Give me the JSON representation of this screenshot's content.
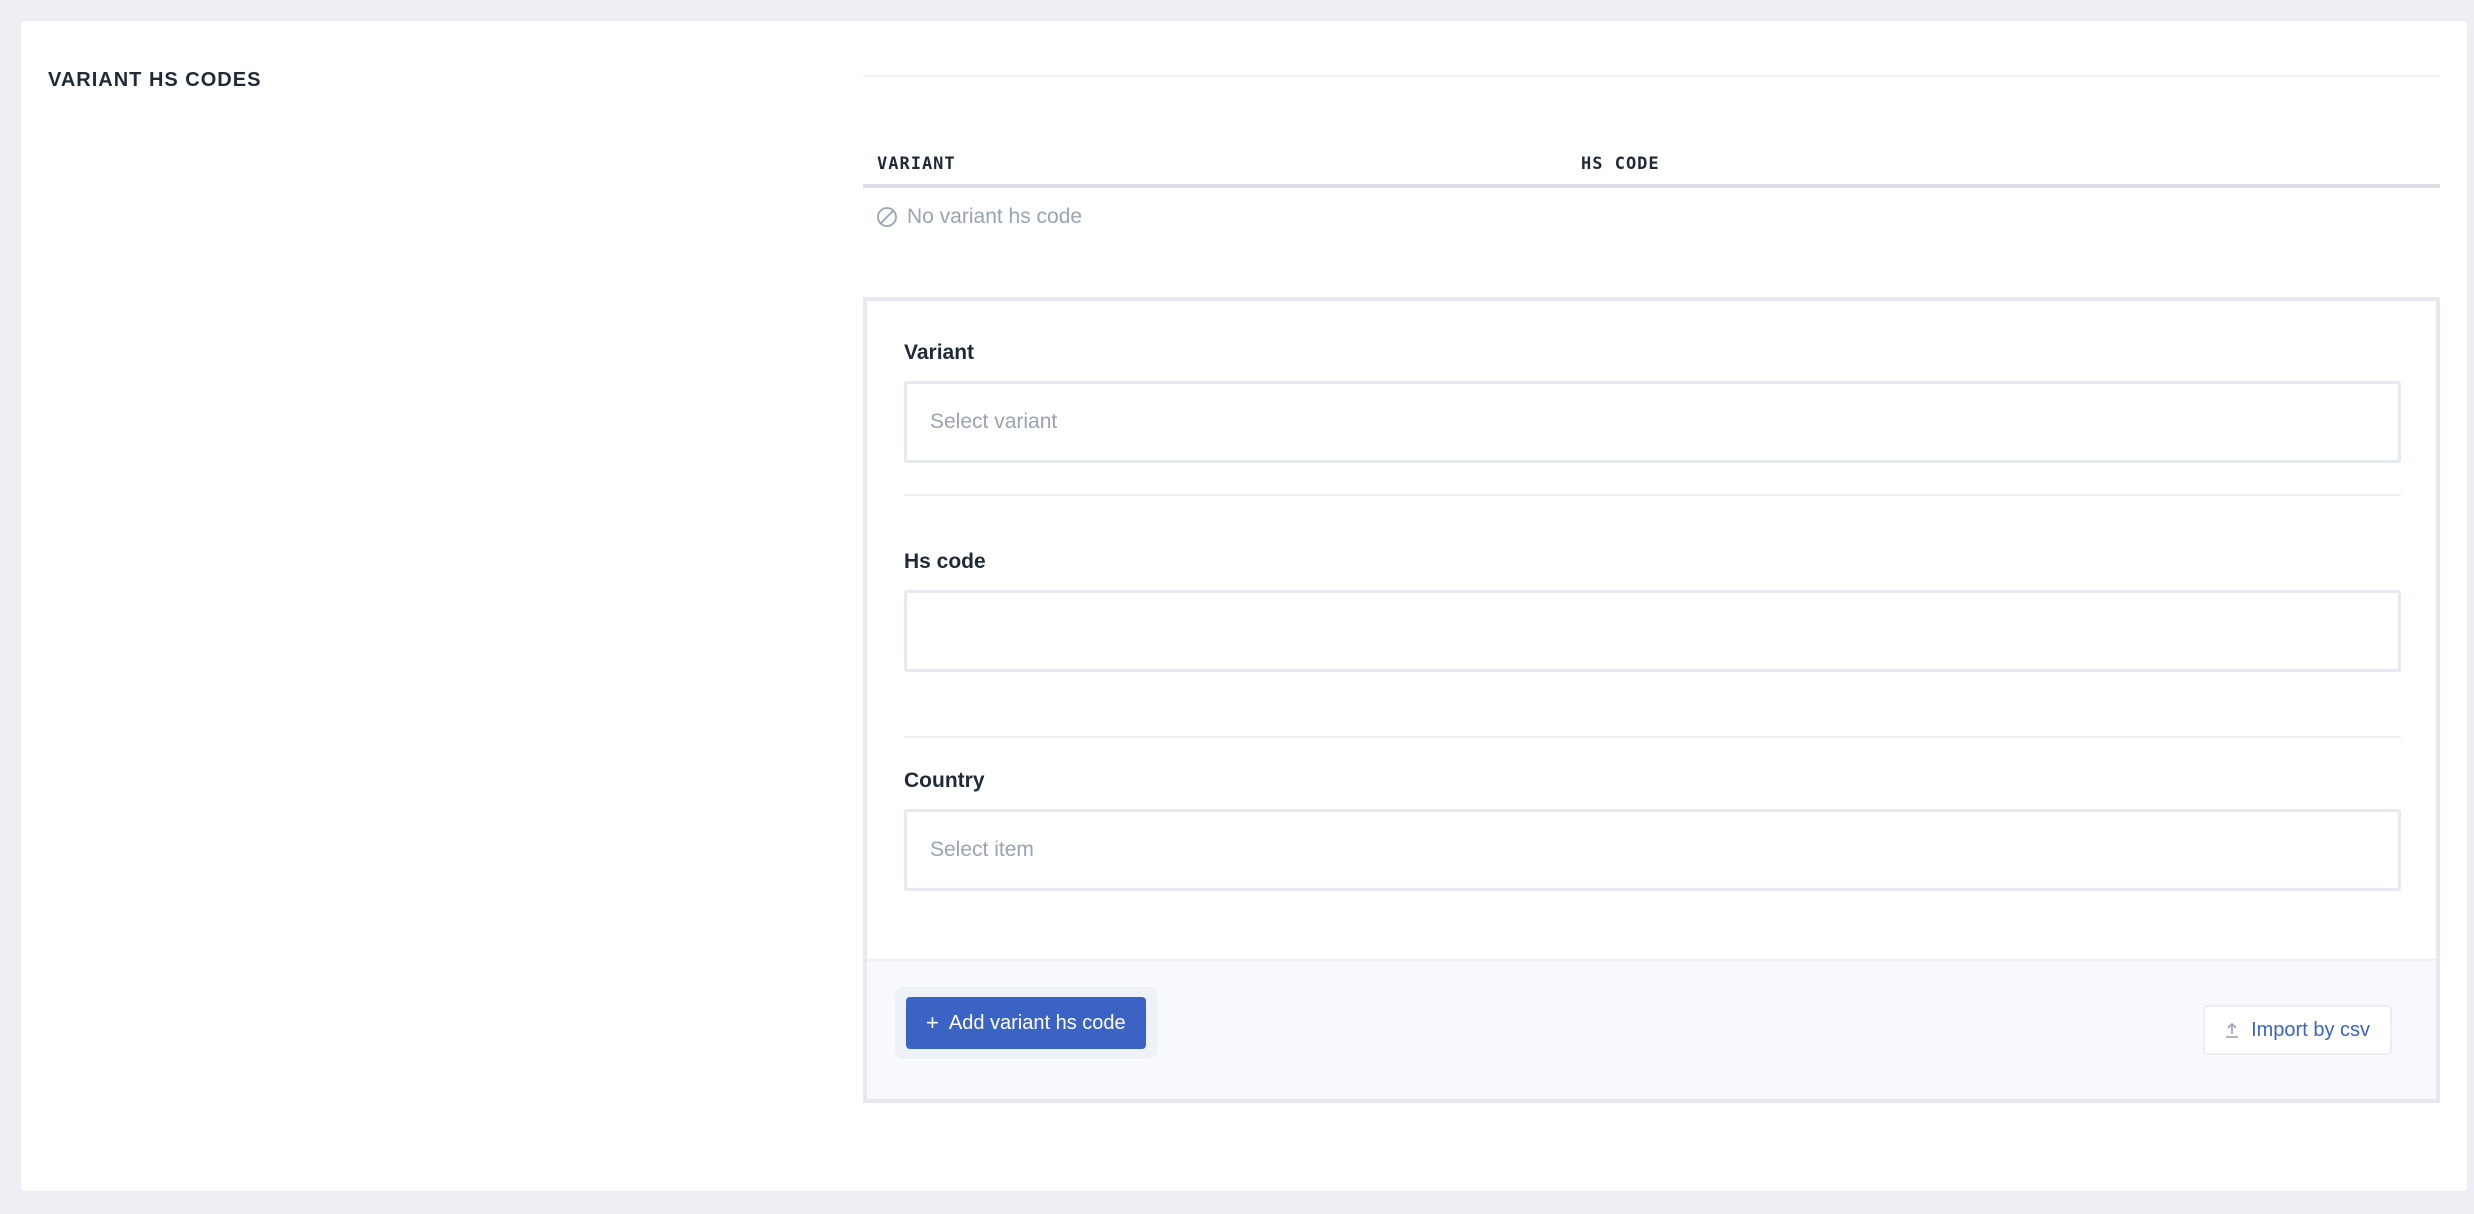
{
  "section": {
    "title": "VARIANT HS CODES"
  },
  "table": {
    "columns": [
      "VARIANT",
      "HS CODE"
    ],
    "empty_text": "No variant hs code"
  },
  "form": {
    "variant": {
      "label": "Variant",
      "placeholder": "Select variant"
    },
    "hs_code": {
      "label": "Hs code",
      "value": ""
    },
    "country": {
      "label": "Country",
      "placeholder": "Select item"
    }
  },
  "actions": {
    "add_label": "Add variant hs code",
    "import_label": "Import by csv"
  },
  "colors": {
    "primary": "#3b63c4",
    "muted_text": "#9aa3b2",
    "border": "#e6e9ef",
    "background": "#eceef3"
  },
  "icons": {
    "empty": "ban-icon",
    "add": "plus-icon",
    "import": "upload-icon"
  }
}
